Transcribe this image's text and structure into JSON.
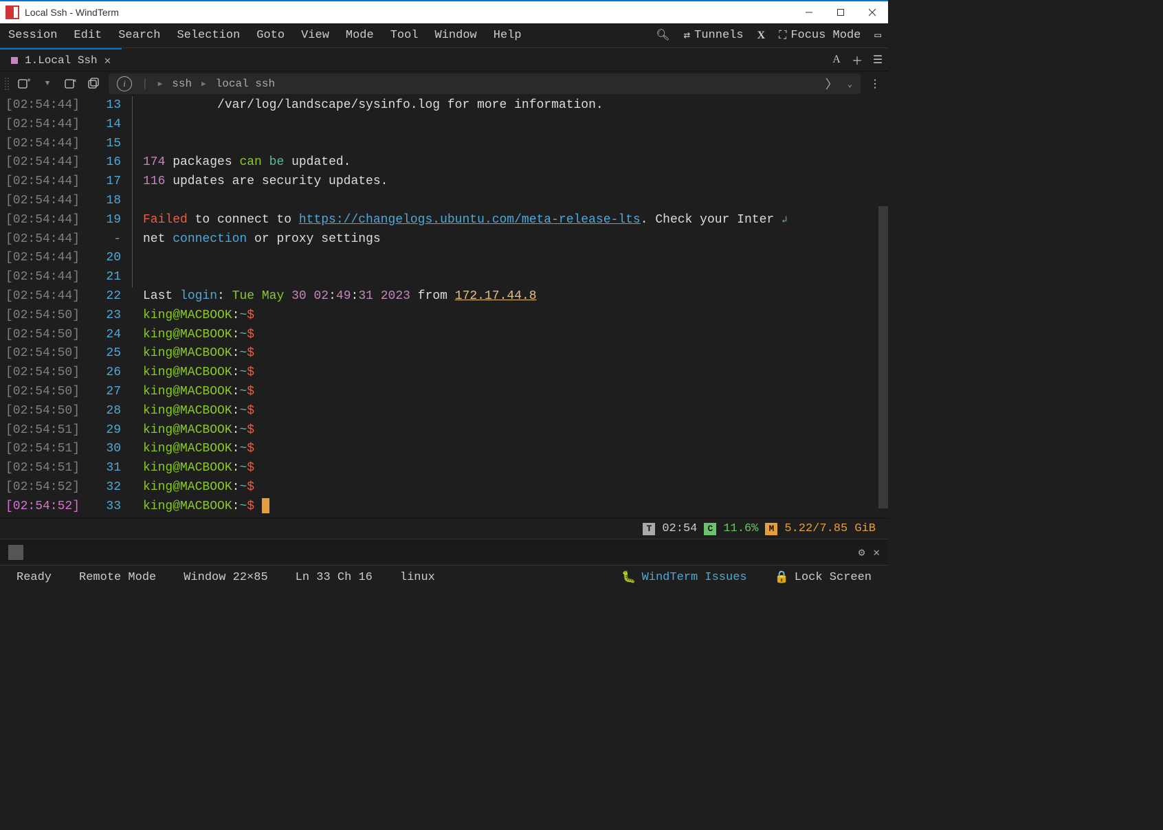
{
  "window": {
    "title": "Local Ssh - WindTerm"
  },
  "menu": {
    "items": [
      "Session",
      "Edit",
      "Search",
      "Selection",
      "Goto",
      "View",
      "Mode",
      "Tool",
      "Window",
      "Help"
    ],
    "tunnels": "Tunnels",
    "focus_mode": "Focus Mode"
  },
  "tab": {
    "label": "1.Local Ssh"
  },
  "breadcrumb": {
    "seg1": "ssh",
    "seg2": "local ssh"
  },
  "terminal": {
    "lines": [
      {
        "ts": "[02:54:44]",
        "ln": "13",
        "segs": [
          {
            "t": "          /var/log/landscape/sysinfo.log for more information.",
            "c": "c-white"
          }
        ]
      },
      {
        "ts": "[02:54:44]",
        "ln": "14",
        "segs": []
      },
      {
        "ts": "[02:54:44]",
        "ln": "15",
        "segs": []
      },
      {
        "ts": "[02:54:44]",
        "ln": "16",
        "segs": [
          {
            "t": "174",
            "c": "c-purple"
          },
          {
            "t": " packages ",
            "c": "c-white"
          },
          {
            "t": "can",
            "c": "c-green"
          },
          {
            "t": " ",
            "c": "c-white"
          },
          {
            "t": "be",
            "c": "c-teal"
          },
          {
            "t": " updated.",
            "c": "c-white"
          }
        ]
      },
      {
        "ts": "[02:54:44]",
        "ln": "17",
        "segs": [
          {
            "t": "116",
            "c": "c-purple"
          },
          {
            "t": " updates are security updates.",
            "c": "c-white"
          }
        ]
      },
      {
        "ts": "[02:54:44]",
        "ln": "18",
        "segs": []
      },
      {
        "ts": "[02:54:44]",
        "ln": "19",
        "segs": [
          {
            "t": "Failed",
            "c": "c-red"
          },
          {
            "t": " to connect to ",
            "c": "c-white"
          },
          {
            "t": "https://changelogs.ubuntu.com/meta-release-lts",
            "c": "c-link"
          },
          {
            "t": ". Check your Inter ",
            "c": "c-white"
          },
          {
            "t": "↲",
            "c": "wrap-icon"
          }
        ]
      },
      {
        "ts": "[02:54:44]",
        "ln": "-",
        "segs": [
          {
            "t": "net ",
            "c": "c-white"
          },
          {
            "t": "connection",
            "c": "c-blue"
          },
          {
            "t": " or proxy settings",
            "c": "c-white"
          }
        ]
      },
      {
        "ts": "[02:54:44]",
        "ln": "20",
        "segs": []
      },
      {
        "ts": "[02:54:44]",
        "ln": "21",
        "segs": []
      },
      {
        "ts": "[02:54:44]",
        "ln": "22",
        "segs": [
          {
            "t": "Last ",
            "c": "c-white"
          },
          {
            "t": "login",
            "c": "c-blue"
          },
          {
            "t": ": ",
            "c": "c-white"
          },
          {
            "t": "Tue May",
            "c": "c-green"
          },
          {
            "t": " ",
            "c": "c-white"
          },
          {
            "t": "30 02",
            "c": "c-purple"
          },
          {
            "t": ":",
            "c": "c-white"
          },
          {
            "t": "49",
            "c": "c-purple"
          },
          {
            "t": ":",
            "c": "c-white"
          },
          {
            "t": "31",
            "c": "c-purple"
          },
          {
            "t": " ",
            "c": "c-white"
          },
          {
            "t": "2023",
            "c": "c-purple"
          },
          {
            "t": " from ",
            "c": "c-white"
          },
          {
            "t": "172.17.44.8",
            "c": "c-yellow",
            "u": true
          }
        ]
      },
      {
        "ts": "[02:54:50]",
        "ln": "23",
        "prompt": true
      },
      {
        "ts": "[02:54:50]",
        "ln": "24",
        "prompt": true
      },
      {
        "ts": "[02:54:50]",
        "ln": "25",
        "prompt": true
      },
      {
        "ts": "[02:54:50]",
        "ln": "26",
        "prompt": true
      },
      {
        "ts": "[02:54:50]",
        "ln": "27",
        "prompt": true
      },
      {
        "ts": "[02:54:50]",
        "ln": "28",
        "prompt": true
      },
      {
        "ts": "[02:54:51]",
        "ln": "29",
        "prompt": true
      },
      {
        "ts": "[02:54:51]",
        "ln": "30",
        "prompt": true
      },
      {
        "ts": "[02:54:51]",
        "ln": "31",
        "prompt": true
      },
      {
        "ts": "[02:54:52]",
        "ln": "32",
        "prompt": true
      },
      {
        "ts": "[02:54:52]",
        "ln": "33",
        "prompt": true,
        "cursor": true,
        "current": true
      }
    ],
    "prompt": {
      "user_host": "king@MACBOOK",
      "colon": ":",
      "path": "~",
      "dollar": "$"
    }
  },
  "meters": {
    "time": "02:54",
    "cpu": "11.6%",
    "mem": "5.22/7.85 GiB"
  },
  "status": {
    "ready": "Ready",
    "remote": "Remote Mode",
    "window": "Window 22×85",
    "pos": "Ln 33 Ch 16",
    "os": "linux",
    "issues": "WindTerm Issues",
    "lock": "Lock Screen"
  }
}
